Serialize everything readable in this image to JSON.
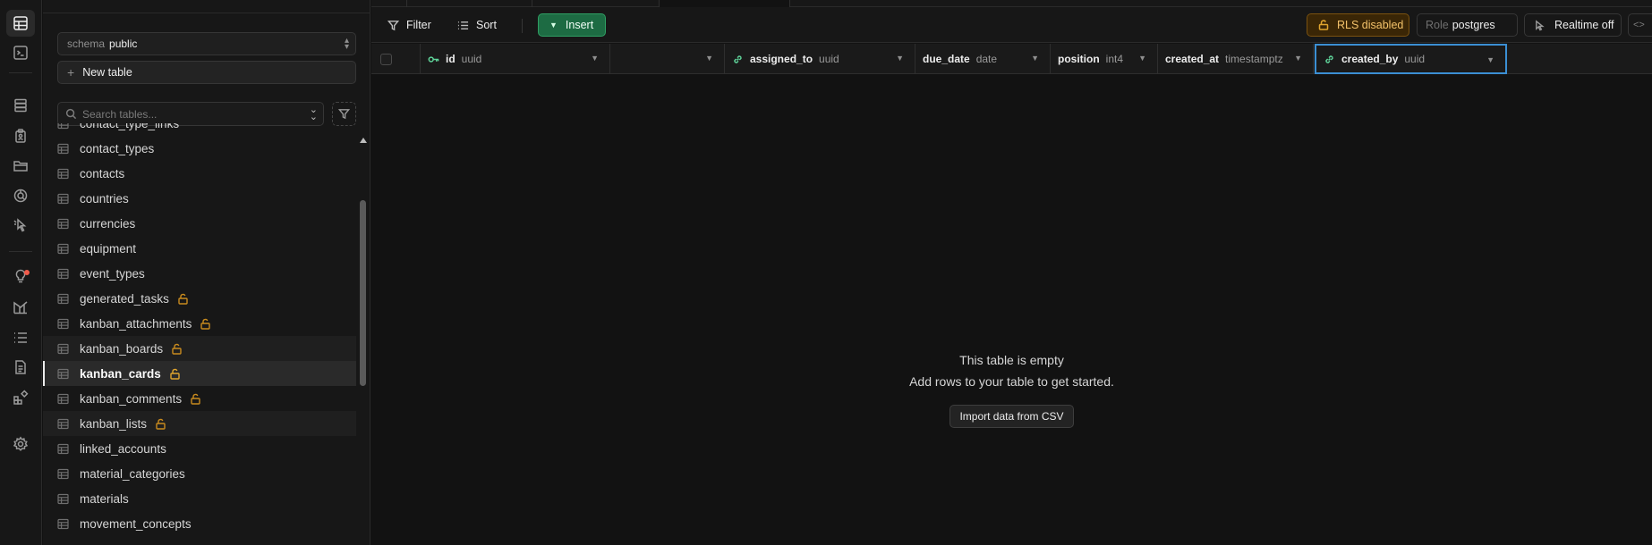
{
  "rail": {
    "icons": [
      "table-editor-icon",
      "sql-editor-icon",
      "database-icon",
      "auth-icon",
      "storage-icon",
      "realtime-icon",
      "edge-functions-icon",
      "advisors-icon",
      "reports-icon",
      "logs-icon",
      "api-docs-icon",
      "integrations-icon",
      "settings-icon"
    ]
  },
  "sidebar": {
    "schema_label": "schema",
    "schema_value": "public",
    "new_table_label": "New table",
    "search_placeholder": "Search tables...",
    "tables": [
      {
        "name": "contact_type_links",
        "rls_disabled": false
      },
      {
        "name": "contact_types",
        "rls_disabled": false
      },
      {
        "name": "contacts",
        "rls_disabled": false
      },
      {
        "name": "countries",
        "rls_disabled": false
      },
      {
        "name": "currencies",
        "rls_disabled": false
      },
      {
        "name": "equipment",
        "rls_disabled": false
      },
      {
        "name": "event_types",
        "rls_disabled": false
      },
      {
        "name": "generated_tasks",
        "rls_disabled": true
      },
      {
        "name": "kanban_attachments",
        "rls_disabled": true
      },
      {
        "name": "kanban_boards",
        "rls_disabled": true
      },
      {
        "name": "kanban_cards",
        "rls_disabled": true,
        "selected": true
      },
      {
        "name": "kanban_comments",
        "rls_disabled": true
      },
      {
        "name": "kanban_lists",
        "rls_disabled": true
      },
      {
        "name": "linked_accounts",
        "rls_disabled": false
      },
      {
        "name": "material_categories",
        "rls_disabled": false
      },
      {
        "name": "materials",
        "rls_disabled": false
      },
      {
        "name": "movement_concepts",
        "rls_disabled": false
      }
    ]
  },
  "toolbar": {
    "filter_label": "Filter",
    "sort_label": "Sort",
    "insert_label": "Insert",
    "rls_label": "RLS disabled",
    "role_label": "Role",
    "role_value": "postgres",
    "realtime_label": "Realtime off",
    "code_label": "<>"
  },
  "columns": [
    {
      "name": "id",
      "type": "uuid",
      "icon": "key-icon"
    },
    {
      "name": "",
      "type": "",
      "icon": ""
    },
    {
      "name": "assigned_to",
      "type": "uuid",
      "icon": "link-icon"
    },
    {
      "name": "due_date",
      "type": "date",
      "icon": ""
    },
    {
      "name": "position",
      "type": "int4",
      "icon": ""
    },
    {
      "name": "created_at",
      "type": "timestamptz",
      "icon": ""
    },
    {
      "name": "created_by",
      "type": "uuid",
      "icon": "link-icon"
    }
  ],
  "empty_state": {
    "title": "This table is empty",
    "subtitle": "Add rows to your table to get started.",
    "import_label": "Import data from CSV"
  },
  "colors": {
    "accent_green": "#1d6b43",
    "warning_amber": "#e0a52e",
    "focus_blue": "#3b8fd4"
  }
}
